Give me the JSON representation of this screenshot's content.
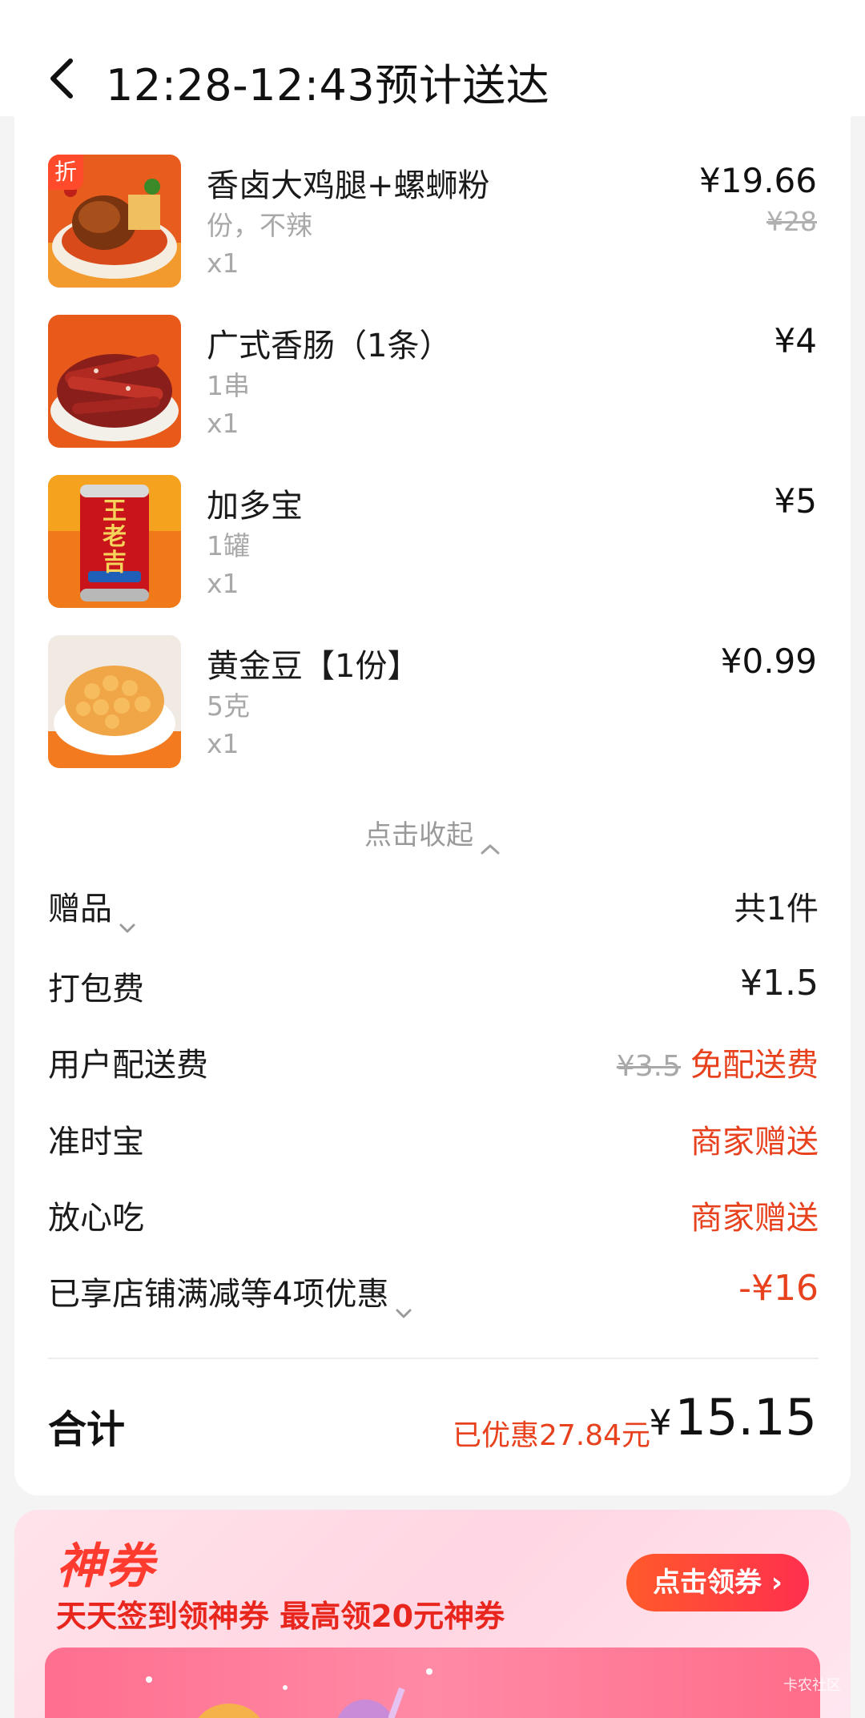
{
  "header": {
    "title": "12:28-12:43预计送达"
  },
  "items": [
    {
      "name": "香卤大鸡腿+螺蛳粉",
      "spec": "份，不辣",
      "qty": "x1",
      "price": "¥19.66",
      "original_price": "¥28",
      "badge": "折",
      "image": "braised-chicken-leg-rice-noodle"
    },
    {
      "name": "广式香肠（1条）",
      "spec": "1串",
      "qty": "x1",
      "price": "¥4",
      "original_price": "",
      "badge": "",
      "image": "cantonese-sausage"
    },
    {
      "name": "加多宝",
      "spec": "1罐",
      "qty": "x1",
      "price": "¥5",
      "original_price": "",
      "badge": "",
      "image": "herbal-tea-can",
      "can_text": "王老吉"
    },
    {
      "name": "黄金豆【1份】",
      "spec": "5克",
      "qty": "x1",
      "price": "¥0.99",
      "original_price": "",
      "badge": "",
      "image": "golden-beans"
    }
  ],
  "collapse_label": "点击收起",
  "fees": {
    "gift": {
      "label": "赠品",
      "value": "共1件"
    },
    "packing": {
      "label": "打包费",
      "value": "¥1.5"
    },
    "delivery": {
      "label": "用户配送费",
      "original": "¥3.5",
      "value": "免配送费"
    },
    "ontime": {
      "label": "准时宝",
      "value": "商家赠送"
    },
    "safe": {
      "label": "放心吃",
      "value": "商家赠送"
    },
    "discounts": {
      "label": "已享店铺满减等4项优惠",
      "value": "-¥16"
    }
  },
  "total": {
    "label": "合计",
    "saved": "已优惠27.84元",
    "currency": "¥",
    "amount": "15.15"
  },
  "promo": {
    "title": "神券",
    "subtitle": "天天签到领神券 最高领20元神券",
    "button": "点击领券"
  },
  "watermark": "卡农社区",
  "colors": {
    "accent_red": "#e8411e",
    "muted_text": "#a8a8a8",
    "background": "#f4f4f4"
  }
}
